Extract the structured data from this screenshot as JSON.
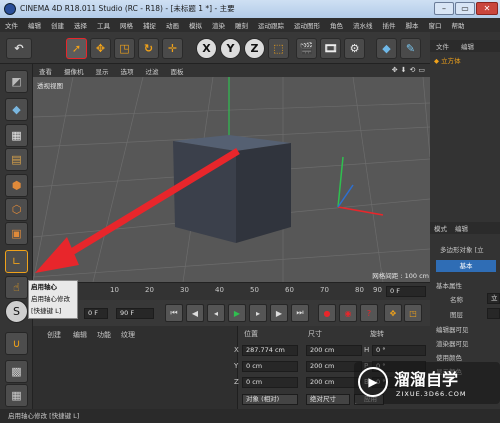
{
  "titlebar": {
    "title": "CINEMA 4D R18.011 Studio (RC - R18) - [未标题 1 *] - 主要",
    "min": "–",
    "max": "▭",
    "close": "✕"
  },
  "menu": [
    "文件",
    "编辑",
    "创建",
    "选择",
    "工具",
    "网格",
    "捕捉",
    "动画",
    "模拟",
    "渲染",
    "雕刻",
    "运动跟踪",
    "运动图形",
    "角色",
    "流水线",
    "插件",
    "脚本",
    "窗口",
    "帮助"
  ],
  "toolbar": {
    "x_label": "X",
    "y_label": "Y",
    "z_label": "Z"
  },
  "viewport": {
    "menus": [
      "查看",
      "摄像机",
      "显示",
      "选项",
      "过滤",
      "面板"
    ],
    "label": "透视视图",
    "grid_label": "网格间距 : 100 cm"
  },
  "timeline": {
    "ticks": [
      "0",
      "10",
      "20",
      "30",
      "40",
      "50",
      "60",
      "70",
      "80",
      "90"
    ],
    "frame_field": "0 F"
  },
  "transport": {
    "start_field": "0 F",
    "end_field": "90 F"
  },
  "tooltip": {
    "title": "启用轴心",
    "line1": "启用轴心修改",
    "line2": "[快捷键 L]"
  },
  "material": {
    "menus": [
      "创建",
      "编辑",
      "功能",
      "纹理"
    ]
  },
  "coords": {
    "headers": [
      "位置",
      "尺寸",
      "旋转"
    ],
    "rows": [
      {
        "axis": "X",
        "pos": "287.774 cm",
        "size": "200 cm",
        "rot_axis": "H",
        "rot": "0 °"
      },
      {
        "axis": "Y",
        "pos": "0 cm",
        "size": "200 cm",
        "rot_axis": "P",
        "rot": "0 °"
      },
      {
        "axis": "Z",
        "pos": "0 cm",
        "size": "200 cm",
        "rot_axis": "B",
        "rot": "0 °"
      }
    ],
    "mode_select": "对象 (相对)",
    "size_select": "绝对尺寸",
    "apply": "应用"
  },
  "right_panel": {
    "menu": [
      "文件",
      "编辑"
    ],
    "object": "立方体",
    "attr_menus": [
      "模式",
      "编辑"
    ],
    "attr_title": "多边形对象 [立",
    "basic_tab": "基本",
    "basic_props": "基本属性",
    "name_label": "名称",
    "name_value": "立",
    "layer_label": "图层",
    "editor_visible": "编辑器可见",
    "render_visible": "渲染器可见",
    "use_color": "使用颜色",
    "display_color": "显示颜色"
  },
  "status": "启用轴心修改 [快捷键 L]",
  "watermark": {
    "brand": "溜溜自学",
    "url": "ZIXUE.3D66.COM"
  },
  "colors": {
    "accent_blue": "#2d6fd1",
    "arrow_red": "#e8262b",
    "active_orange": "#f0a21a"
  }
}
